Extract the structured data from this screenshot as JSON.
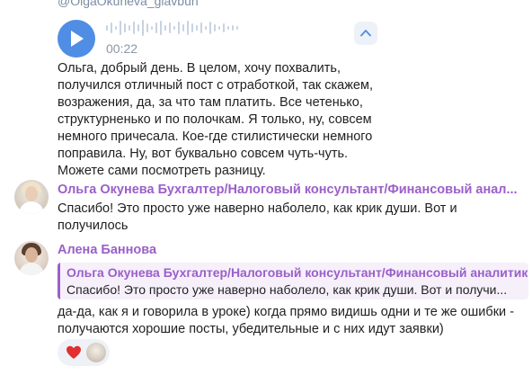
{
  "top_handle": "@OlgaOkuneva_glavbuh",
  "voice_message": {
    "duration": "00:22"
  },
  "message_main": {
    "text": "Ольга, добрый день. В целом, хочу похвалить, получился отличный пост с отработкой, так скажем, возражения, да, за что там платить. Все четенько, структурненько и по полочкам. Я только, ну, совсем немного причесала. Кое-где стилистически немного поправила. Ну, вот буквально совсем чуть-чуть. Можете сами посмотреть разницу."
  },
  "message_olga": {
    "author": "Ольга Окунева Бухгалтер/Налоговый консультант/Финансовый анал...",
    "text": "Спасибо! Это просто уже наверно наболело, как крик души. Вот и получилось"
  },
  "message_alena": {
    "author": "Алена Баннова",
    "reply": {
      "author": "Ольга Окунева Бухгалтер/Налоговый консультант/Финансовый аналитик",
      "text": "Спасибо! Это просто уже наверно наболело, как крик души. Вот и получи..."
    },
    "text": "да-да, как я и говорила в уроке) когда прямо видишь одни и те же ошибки - получаются хорошие посты, убедительные и с них идут заявки)"
  },
  "reaction": {
    "emoji": "heart-icon",
    "color": "#e0312f"
  },
  "colors": {
    "accent": "#4f8ee4",
    "author": "#9a5fc9",
    "reply_bg": "#f6f0fb"
  }
}
